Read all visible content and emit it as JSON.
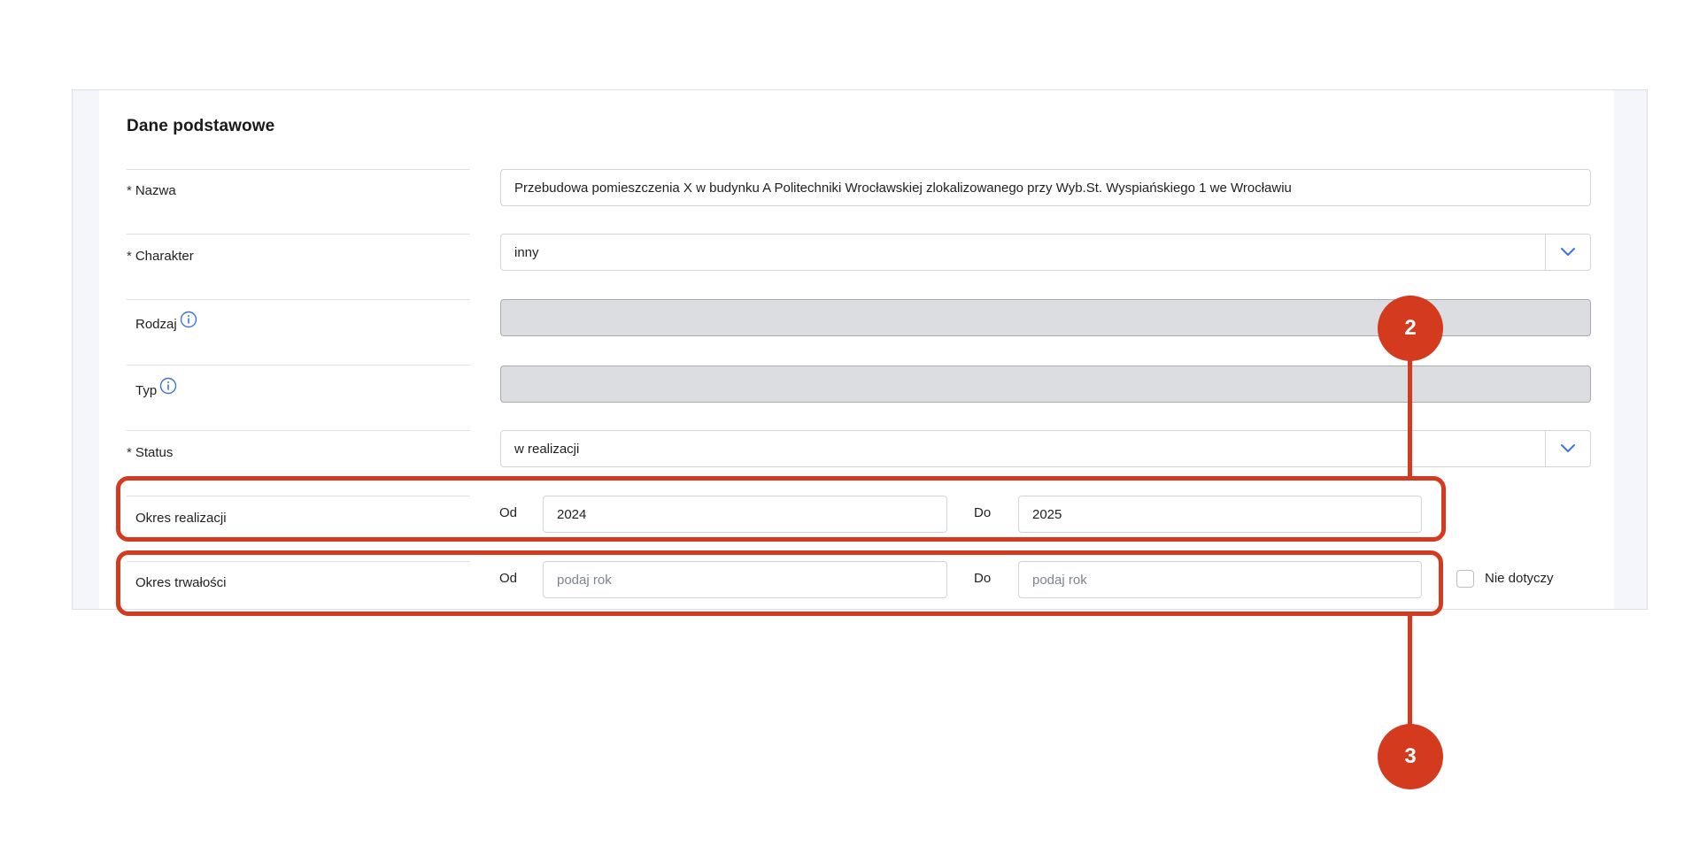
{
  "section": {
    "title": "Dane podstawowe"
  },
  "fields": {
    "nazwa": {
      "required_mark": "*",
      "label": "Nazwa",
      "value": "Przebudowa pomieszczenia X w budynku A Politechniki Wrocławskiej zlokalizowanego przy Wyb.St. Wyspiańskiego 1 we Wrocławiu"
    },
    "charakter": {
      "required_mark": "*",
      "label": "Charakter",
      "value": "inny"
    },
    "rodzaj": {
      "label": "Rodzaj",
      "value": ""
    },
    "typ": {
      "label": "Typ",
      "value": ""
    },
    "status": {
      "required_mark": "*",
      "label": "Status",
      "value": "w realizacji"
    },
    "okres_realizacji": {
      "label": "Okres realizacji",
      "od_label": "Od",
      "od_value": "2024",
      "do_label": "Do",
      "do_value": "2025"
    },
    "okres_trwalosci": {
      "label": "Okres trwałości",
      "od_label": "Od",
      "od_placeholder": "podaj rok",
      "do_label": "Do",
      "do_placeholder": "podaj rok",
      "checkbox_label": "Nie dotyczy"
    }
  },
  "annotations": {
    "badge_2": "2",
    "badge_3": "3"
  },
  "colors": {
    "accent": "#d43a1e",
    "chevron": "#3b74e0",
    "info_icon": "#3b74e0"
  }
}
